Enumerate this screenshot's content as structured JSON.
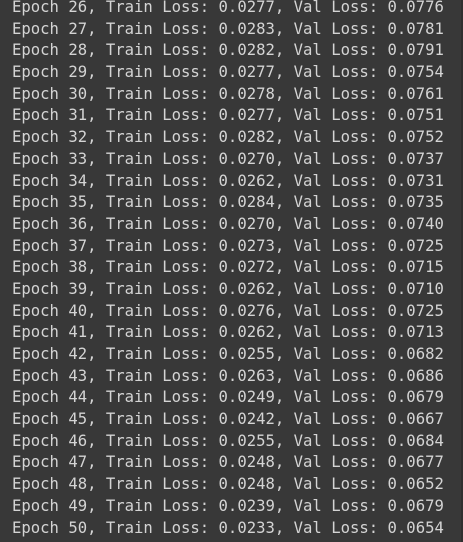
{
  "output": {
    "lines": [
      "Epoch 26, Train Loss: 0.0277, Val Loss: 0.0776",
      "Epoch 27, Train Loss: 0.0283, Val Loss: 0.0781",
      "Epoch 28, Train Loss: 0.0282, Val Loss: 0.0791",
      "Epoch 29, Train Loss: 0.0277, Val Loss: 0.0754",
      "Epoch 30, Train Loss: 0.0278, Val Loss: 0.0761",
      "Epoch 31, Train Loss: 0.0277, Val Loss: 0.0751",
      "Epoch 32, Train Loss: 0.0282, Val Loss: 0.0752",
      "Epoch 33, Train Loss: 0.0270, Val Loss: 0.0737",
      "Epoch 34, Train Loss: 0.0262, Val Loss: 0.0731",
      "Epoch 35, Train Loss: 0.0284, Val Loss: 0.0735",
      "Epoch 36, Train Loss: 0.0270, Val Loss: 0.0740",
      "Epoch 37, Train Loss: 0.0273, Val Loss: 0.0725",
      "Epoch 38, Train Loss: 0.0272, Val Loss: 0.0715",
      "Epoch 39, Train Loss: 0.0262, Val Loss: 0.0710",
      "Epoch 40, Train Loss: 0.0276, Val Loss: 0.0725",
      "Epoch 41, Train Loss: 0.0262, Val Loss: 0.0713",
      "Epoch 42, Train Loss: 0.0255, Val Loss: 0.0682",
      "Epoch 43, Train Loss: 0.0263, Val Loss: 0.0686",
      "Epoch 44, Train Loss: 0.0249, Val Loss: 0.0679",
      "Epoch 45, Train Loss: 0.0242, Val Loss: 0.0667",
      "Epoch 46, Train Loss: 0.0255, Val Loss: 0.0684",
      "Epoch 47, Train Loss: 0.0248, Val Loss: 0.0677",
      "Epoch 48, Train Loss: 0.0248, Val Loss: 0.0652",
      "Epoch 49, Train Loss: 0.0239, Val Loss: 0.0679",
      "Epoch 50, Train Loss: 0.0233, Val Loss: 0.0654"
    ]
  },
  "colors": {
    "background": "#383838",
    "text": "#d4d4d4"
  }
}
